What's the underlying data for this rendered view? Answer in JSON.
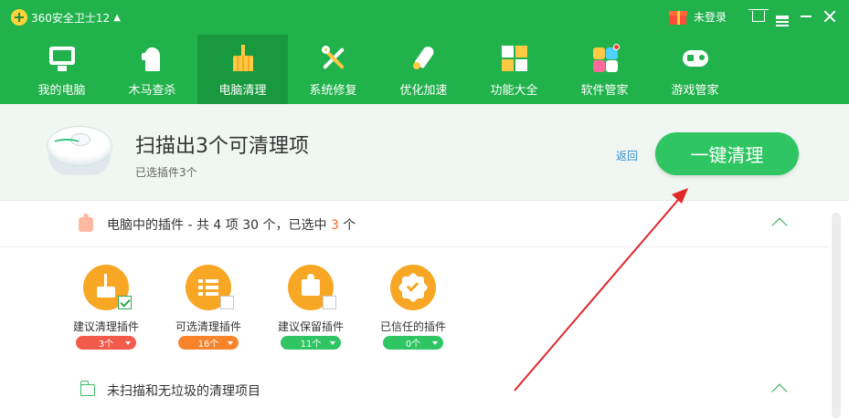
{
  "app": {
    "title": "360安全卫士12",
    "login_text": "未登录"
  },
  "nav": {
    "items": [
      {
        "label": "我的电脑",
        "icon": "monitor-icon"
      },
      {
        "label": "木马查杀",
        "icon": "trojan-horse-icon"
      },
      {
        "label": "电脑清理",
        "icon": "broom-icon",
        "active": true
      },
      {
        "label": "系统修复",
        "icon": "wrench-icon"
      },
      {
        "label": "优化加速",
        "icon": "rocket-icon"
      },
      {
        "label": "功能大全",
        "icon": "grid-icon"
      },
      {
        "label": "软件管家",
        "icon": "software-icon"
      },
      {
        "label": "游戏管家",
        "icon": "gamepad-icon"
      }
    ]
  },
  "summary": {
    "title": "扫描出3个可清理项",
    "subtitle": "已选插件3个",
    "back_label": "返回",
    "primary_label": "一键清理"
  },
  "plugins_section": {
    "prefix": "电脑中的插件 - 共 4 项 30 个，已选中 ",
    "selected": "3",
    "suffix": " 个",
    "categories": [
      {
        "label": "建议清理插件",
        "count": "3个",
        "color": "#f25a4a",
        "checked": true
      },
      {
        "label": "可选清理插件",
        "count": "16个",
        "color": "#f7842a",
        "checked": false
      },
      {
        "label": "建议保留插件",
        "count": "11个",
        "color": "#2ec562",
        "checked": false
      },
      {
        "label": "已信任的插件",
        "count": "0个",
        "color": "#2ec562",
        "checked": false
      }
    ]
  },
  "unscanned_section": {
    "title": "未扫描和无垃圾的清理项目"
  },
  "colors": {
    "brand_green": "#21b24b",
    "accent_orange": "#ff6a2a",
    "annotation_red": "#e02828"
  }
}
